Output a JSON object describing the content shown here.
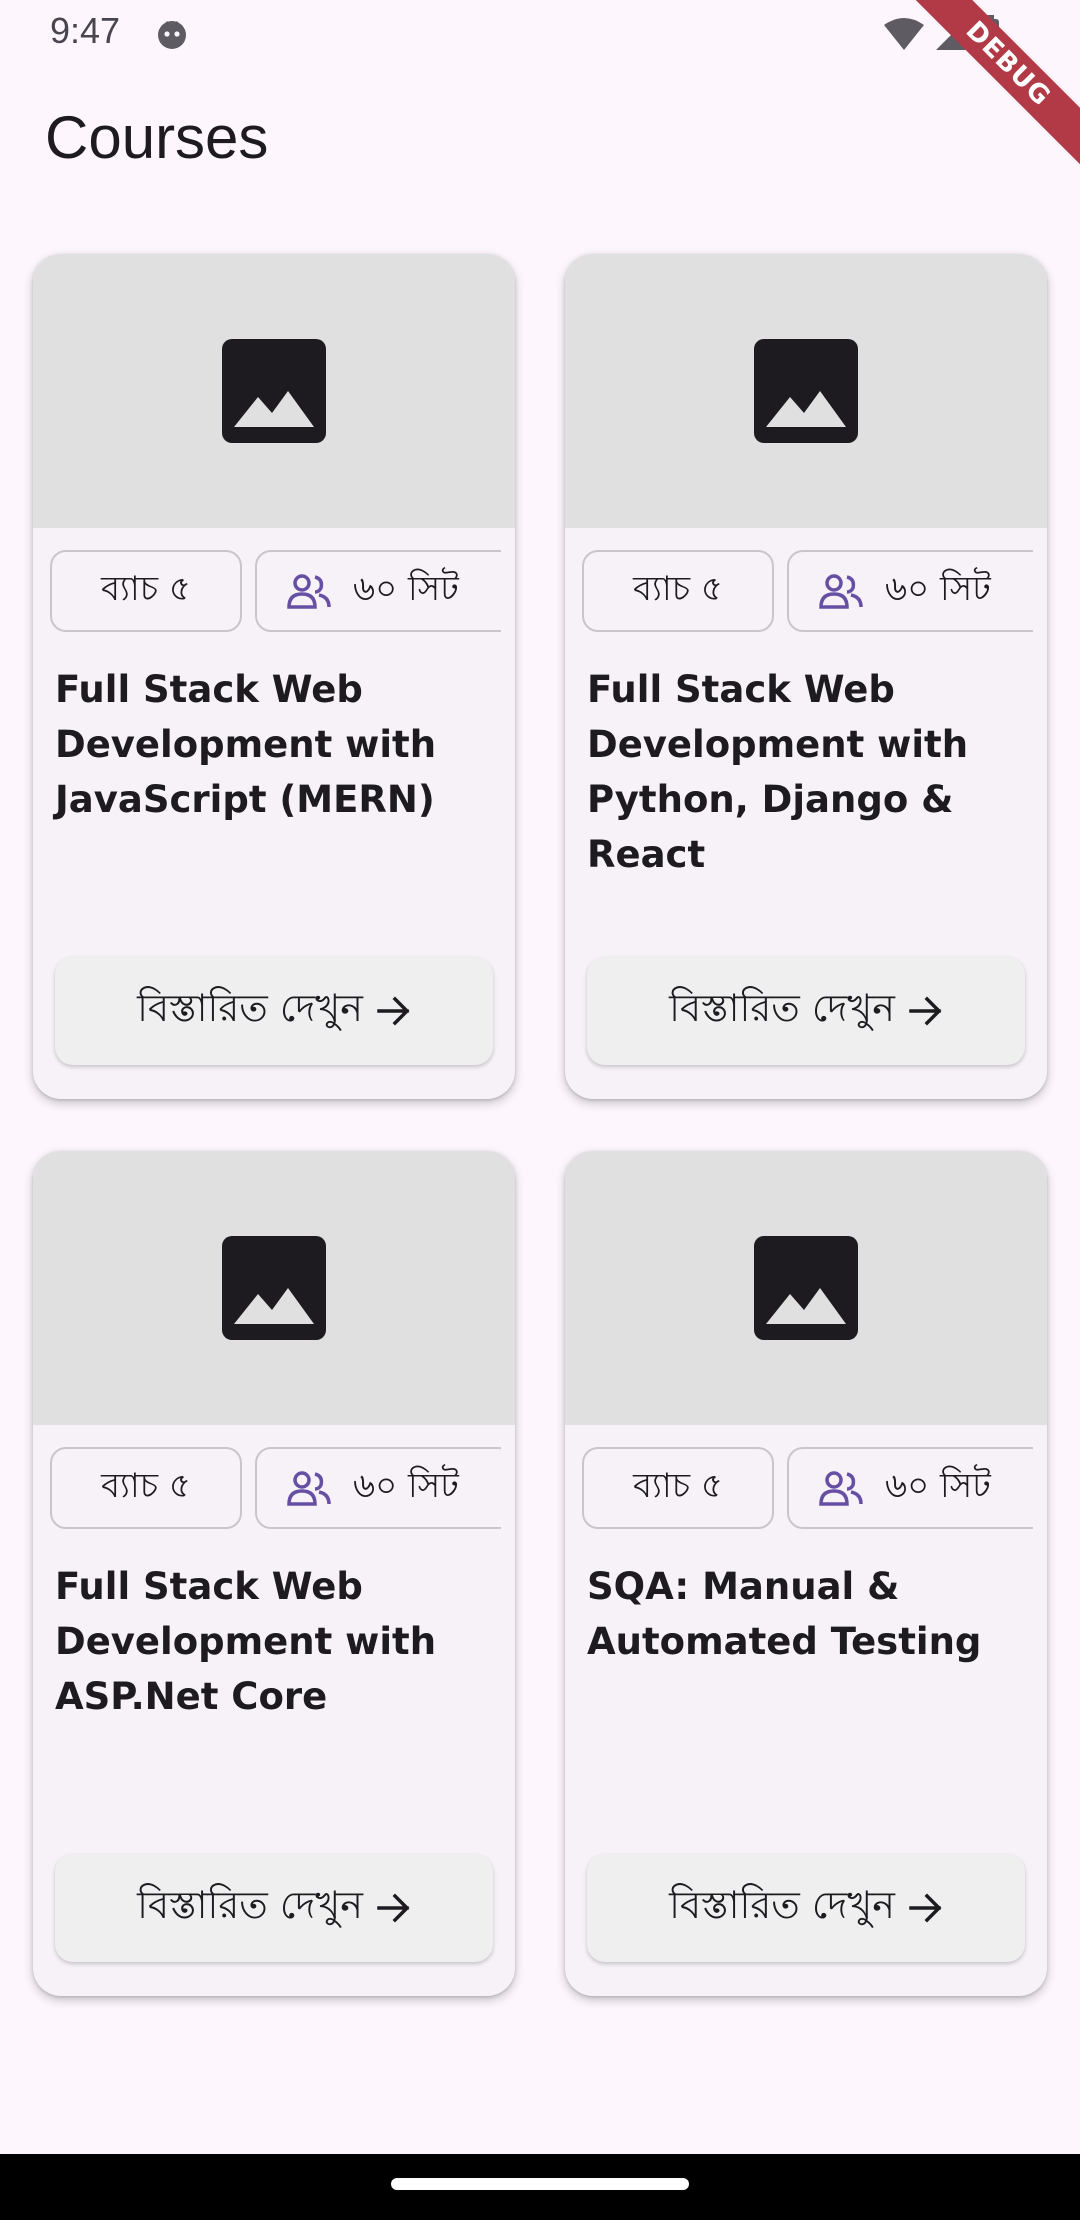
{
  "status_bar": {
    "time": "9:47",
    "icons": [
      "notification-face-icon",
      "wifi-icon",
      "signal-icon",
      "battery-icon"
    ]
  },
  "debug_banner": "DEBUG",
  "page": {
    "title": "Courses"
  },
  "courses": [
    {
      "batch": "ব্যাচ ৫",
      "seats": "৬০ সিট",
      "title": "Full Stack Web Development with JavaScript (MERN)",
      "button_label": "বিস্তারিত দেখুন"
    },
    {
      "batch": "ব্যাচ ৫",
      "seats": "৬০ সিট",
      "title": "Full Stack Web Development with Python, Django & React",
      "button_label": "বিস্তারিত দেখুন"
    },
    {
      "batch": "ব্যাচ ৫",
      "seats": "৬০ সিট",
      "title": "Full Stack Web Development with ASP.Net Core",
      "button_label": "বিস্তারিত দেখুন"
    },
    {
      "batch": "ব্যাচ ৫",
      "seats": "৬০ সিট",
      "title": "SQA: Manual & Automated Testing",
      "button_label": "বিস্তারিত দেখুন"
    }
  ],
  "colors": {
    "background": "#fdf7fd",
    "card": "#f6f2f8",
    "image_placeholder": "#e0e0e0",
    "accent": "#6750a4",
    "debug_ribbon": "#b13a46"
  }
}
